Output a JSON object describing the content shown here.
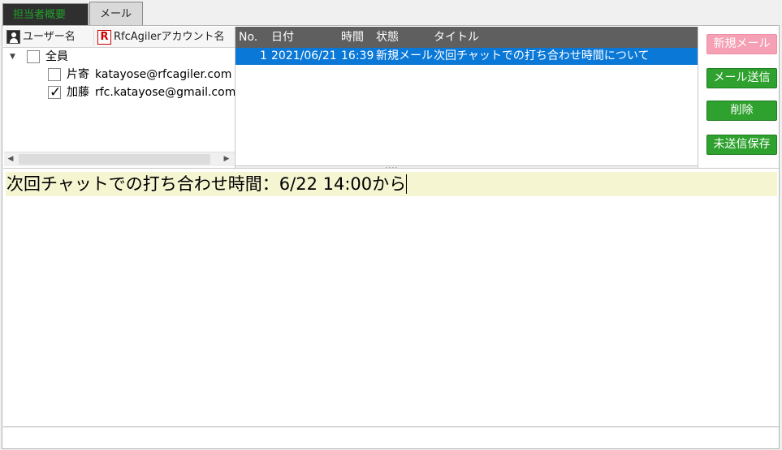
{
  "tabs": [
    {
      "label": "担当者概要"
    },
    {
      "label": "メール"
    }
  ],
  "users_pane": {
    "col_user": "ユーザー名",
    "col_account": "RfcAgilerアカウント名",
    "group": {
      "name": "全員",
      "checked": false,
      "expanded": true
    },
    "members": [
      {
        "name": "片寄",
        "account": "katayose@rfcagiler.com",
        "checked": false
      },
      {
        "name": "加藤",
        "account": "rfc.katayose@gmail.com",
        "checked": true
      }
    ]
  },
  "mail_list": {
    "headers": {
      "no": "No.",
      "date": "日付",
      "time": "時間",
      "status": "状態",
      "title": "タイトル"
    },
    "rows": [
      {
        "no": "1",
        "date": "2021/06/21",
        "time": "16:39",
        "status": "新規メール",
        "title": "次回チャットでの打ち合わせ時間について"
      }
    ]
  },
  "buttons": {
    "new_mail": "新規メール",
    "send": "メール送信",
    "delete": "削除",
    "save_unsent": "未送信保存"
  },
  "editor": {
    "text": "次回チャットでの打ち合わせ時間：6/22 14:00から"
  },
  "colors": {
    "selection": "#0a78d7",
    "button_green": "#2ea12e",
    "button_pink": "#f5a0b4",
    "editor_highlight": "#f5f5d2"
  }
}
